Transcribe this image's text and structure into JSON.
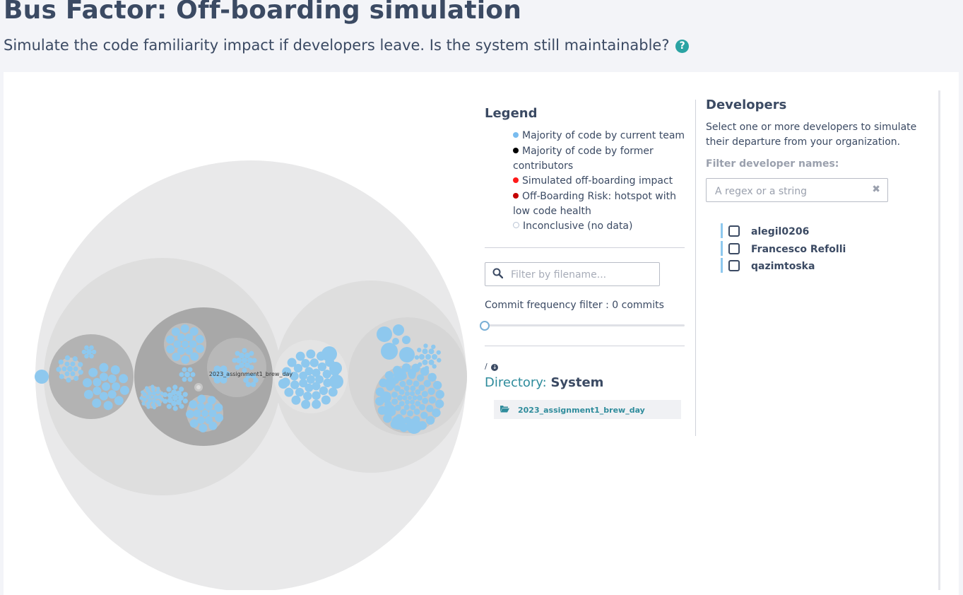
{
  "header": {
    "title": "Bus Factor: Off-boarding simulation",
    "subtitle": "Simulate the code familiarity impact if developers leave. Is the system still maintainable?",
    "help_icon": "question-circle-icon",
    "help_symbol": "?"
  },
  "visualization": {
    "center_label": "2023_assignment1_brew_day",
    "colors": {
      "current_team": "#8ec8ee",
      "former_contributors": "#000000",
      "offboarding_impact": "#ff1a1a",
      "risk_hotspot": "#c40000",
      "outer": "#e9e9ea",
      "mid": "#dedede",
      "inner": "#c9c9c9",
      "dir_dark": "#a8a8a8"
    }
  },
  "legend": {
    "title": "Legend",
    "items": [
      {
        "label": "Majority of code by current team",
        "color": "#79bcef",
        "hollow": false
      },
      {
        "label": "Majority of code by former contributors",
        "color": "#000000",
        "hollow": false
      },
      {
        "label": "Simulated off-boarding impact",
        "color": "#ff1a1a",
        "hollow": false
      },
      {
        "label": "Off-Boarding Risk: hotspot with low code health",
        "color": "#c40000",
        "hollow": false
      },
      {
        "label": "Inconclusive (no data)",
        "color": "#ffffff",
        "hollow": true
      }
    ]
  },
  "file_filter": {
    "placeholder": "Filter by filename...",
    "value": "",
    "icon": "search-icon"
  },
  "commit_filter": {
    "label": "Commit frequency filter : 0 commits",
    "value": 0
  },
  "directory": {
    "path": "/",
    "path_icon": "arrow-circle-down-icon",
    "prefix": "Directory:",
    "name": "System",
    "children": [
      {
        "name": "2023_assignment1_brew_day",
        "icon": "folder-open-icon"
      }
    ]
  },
  "developers": {
    "title": "Developers",
    "description": "Select one or more developers to simulate their departure from your organization.",
    "filter_label": "Filter developer names:",
    "filter_placeholder": "A regex or a string",
    "filter_value": "",
    "clear_icon": "times-icon",
    "clear_symbol": "✖",
    "list": [
      {
        "name": "alegil0206",
        "checked": false
      },
      {
        "name": "Francesco Refolli",
        "checked": false
      },
      {
        "name": "qazimtoska",
        "checked": false
      }
    ]
  }
}
